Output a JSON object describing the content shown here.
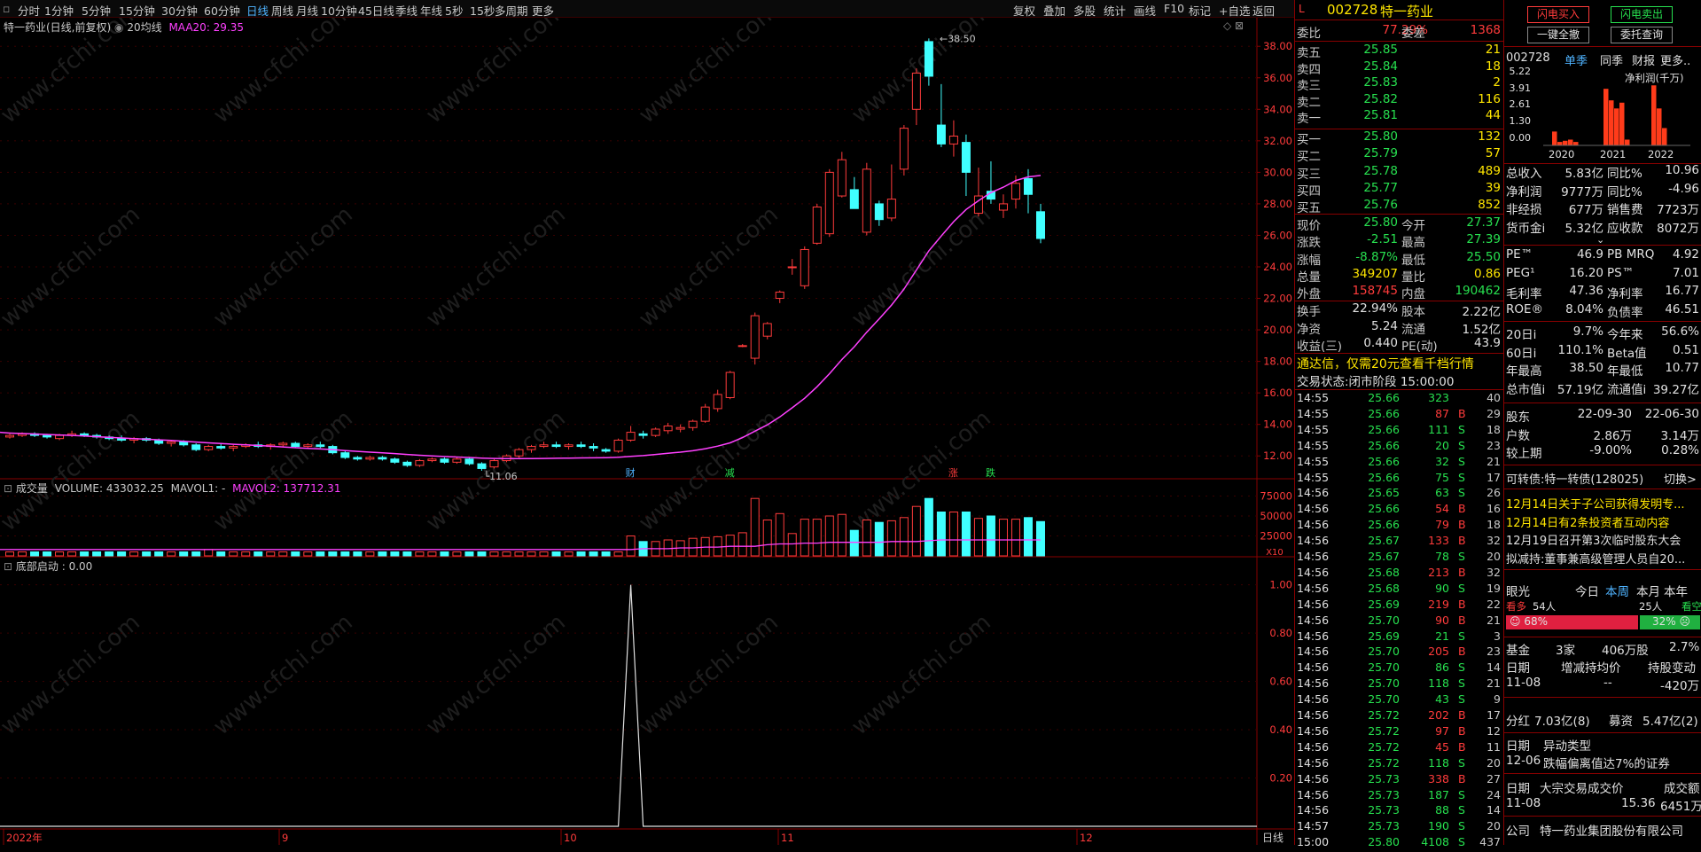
{
  "toolbar": {
    "periods": [
      "分时",
      "1分钟",
      "5分钟",
      "15分钟",
      "30分钟",
      "60分钟",
      "日线",
      "周线",
      "月线",
      "10分钟",
      "45日线",
      "季线",
      "年线",
      "5秒",
      "15秒",
      "多周期",
      "更多"
    ],
    "active": "日线",
    "right": [
      "复权",
      "叠加",
      "多股",
      "统计",
      "画线",
      "F10",
      "标记",
      "+自选",
      "返回"
    ]
  },
  "main_legend": {
    "title": "特一药业(日线,前复权)",
    "ma_name": "20均线",
    "ma_value": "MAA20: 29.35"
  },
  "volume_legend": {
    "label": "成交量",
    "volume": "VOLUME: 433032.25",
    "mavol1": "MAVOL1: -",
    "mavol2": "MAVOL2: 137712.31"
  },
  "indicator_legend": {
    "label": "底部启动",
    "value": ": 0.00"
  },
  "price_axis": [
    "38.00",
    "36.00",
    "34.00",
    "32.00",
    "30.00",
    "28.00",
    "26.00",
    "24.00",
    "22.00",
    "20.00",
    "18.00",
    "16.00",
    "14.00",
    "12.00"
  ],
  "volume_axis": [
    "75000",
    "50000",
    "25000"
  ],
  "volume_unit": "X10",
  "indicator_axis": [
    "1.00",
    "0.80",
    "0.60",
    "0.40",
    "0.20"
  ],
  "time_axis": [
    "2022年",
    "9",
    "10",
    "11",
    "12"
  ],
  "period_label": "日线",
  "annotations": {
    "high": "38.50",
    "low": "11.06",
    "events": [
      "财",
      "减",
      "涨",
      "跌"
    ]
  },
  "watermark": "www.cfchi.com",
  "chart_data": {
    "type": "candlestick",
    "symbol": "特一药业",
    "ylim": [
      11,
      38.8
    ],
    "candles": [
      [
        13.2,
        13.4,
        13.1,
        13.3
      ],
      [
        13.3,
        13.5,
        13.2,
        13.4
      ],
      [
        13.4,
        13.5,
        13.2,
        13.3
      ],
      [
        13.3,
        13.4,
        13.1,
        13.2
      ],
      [
        13.1,
        13.4,
        13.0,
        13.3
      ],
      [
        13.3,
        13.6,
        13.2,
        13.4
      ],
      [
        13.4,
        13.5,
        13.2,
        13.3
      ],
      [
        13.3,
        13.4,
        13.1,
        13.2
      ],
      [
        13.2,
        13.3,
        13.0,
        13.1
      ],
      [
        13.1,
        13.3,
        12.9,
        13.0
      ],
      [
        13.0,
        13.2,
        12.8,
        13.1
      ],
      [
        13.1,
        13.2,
        12.9,
        13.0
      ],
      [
        13.0,
        13.1,
        12.7,
        12.8
      ],
      [
        12.8,
        13.0,
        12.6,
        12.9
      ],
      [
        12.9,
        13.0,
        12.6,
        12.7
      ],
      [
        12.7,
        12.8,
        12.3,
        12.4
      ],
      [
        12.4,
        12.7,
        12.3,
        12.6
      ],
      [
        12.6,
        12.8,
        12.4,
        12.5
      ],
      [
        12.5,
        12.7,
        12.3,
        12.6
      ],
      [
        12.6,
        12.8,
        12.5,
        12.7
      ],
      [
        12.7,
        12.9,
        12.5,
        12.6
      ],
      [
        12.6,
        12.8,
        12.4,
        12.7
      ],
      [
        12.7,
        12.9,
        12.6,
        12.8
      ],
      [
        12.8,
        12.9,
        12.5,
        12.6
      ],
      [
        12.6,
        12.8,
        12.5,
        12.7
      ],
      [
        12.7,
        12.9,
        12.5,
        12.6
      ],
      [
        12.6,
        12.7,
        12.1,
        12.2
      ],
      [
        12.2,
        12.3,
        11.8,
        11.9
      ],
      [
        11.9,
        12.0,
        11.7,
        11.8
      ],
      [
        11.8,
        12.0,
        11.7,
        11.9
      ],
      [
        11.9,
        12.0,
        11.7,
        11.8
      ],
      [
        11.8,
        11.9,
        11.5,
        11.6
      ],
      [
        11.6,
        11.7,
        11.3,
        11.4
      ],
      [
        11.4,
        11.8,
        11.3,
        11.7
      ],
      [
        11.7,
        11.9,
        11.6,
        11.8
      ],
      [
        11.8,
        11.9,
        11.5,
        11.6
      ],
      [
        11.6,
        11.9,
        11.5,
        11.8
      ],
      [
        11.8,
        11.9,
        11.4,
        11.5
      ],
      [
        11.5,
        11.6,
        11.06,
        11.2
      ],
      [
        11.3,
        11.8,
        11.2,
        11.7
      ],
      [
        11.7,
        12.1,
        11.6,
        12.0
      ],
      [
        12.0,
        12.5,
        11.9,
        12.4
      ],
      [
        12.4,
        12.7,
        12.2,
        12.6
      ],
      [
        12.6,
        12.9,
        12.5,
        12.7
      ],
      [
        12.7,
        12.9,
        12.5,
        12.6
      ],
      [
        12.6,
        12.8,
        12.4,
        12.7
      ],
      [
        12.7,
        12.9,
        12.5,
        12.6
      ],
      [
        12.6,
        12.8,
        12.3,
        12.5
      ],
      [
        12.4,
        12.5,
        12.2,
        12.3
      ],
      [
        12.3,
        13.1,
        12.2,
        13.0
      ],
      [
        13.0,
        13.9,
        12.9,
        13.5
      ],
      [
        13.4,
        13.6,
        13.1,
        13.3
      ],
      [
        13.3,
        13.8,
        13.2,
        13.7
      ],
      [
        13.6,
        14.1,
        13.4,
        13.9
      ],
      [
        13.7,
        14.0,
        13.5,
        13.8
      ],
      [
        13.8,
        14.3,
        13.6,
        14.2
      ],
      [
        14.2,
        15.3,
        14.1,
        15.1
      ],
      [
        15.0,
        16.2,
        14.8,
        15.9
      ],
      [
        15.7,
        17.4,
        15.6,
        17.3
      ],
      [
        19.0,
        19.1,
        18.9,
        19.0
      ],
      [
        18.2,
        21.1,
        17.8,
        20.9
      ],
      [
        19.6,
        20.5,
        19.4,
        20.4
      ],
      [
        22.0,
        22.5,
        21.7,
        22.4
      ],
      [
        24.0,
        24.5,
        23.5,
        24.0
      ],
      [
        22.8,
        25.3,
        22.6,
        25.1
      ],
      [
        25.5,
        28.0,
        25.4,
        27.8
      ],
      [
        26.1,
        30.2,
        25.9,
        30.0
      ],
      [
        28.5,
        31.3,
        28.4,
        30.8
      ],
      [
        28.9,
        29.7,
        28.2,
        27.7
      ],
      [
        26.2,
        30.6,
        26.0,
        30.2
      ],
      [
        28.0,
        28.2,
        26.6,
        27.0
      ],
      [
        27.1,
        30.5,
        26.9,
        28.3
      ],
      [
        30.2,
        33.0,
        29.8,
        32.8
      ],
      [
        34.0,
        36.6,
        33.0,
        36.3
      ],
      [
        38.3,
        38.5,
        35.5,
        36.1
      ],
      [
        33.0,
        35.6,
        31.6,
        31.8
      ],
      [
        31.8,
        33.3,
        31.0,
        32.3
      ],
      [
        31.9,
        32.4,
        28.5,
        30.0
      ],
      [
        27.4,
        30.3,
        27.2,
        28.5
      ],
      [
        28.8,
        30.7,
        28.0,
        28.3
      ],
      [
        27.6,
        28.6,
        27.1,
        28.0
      ],
      [
        28.3,
        29.8,
        27.7,
        29.3
      ],
      [
        29.6,
        30.2,
        27.4,
        28.6
      ],
      [
        27.5,
        28.0,
        25.5,
        25.8
      ]
    ],
    "volume": [
      5,
      5,
      5,
      5,
      5,
      5,
      5,
      5,
      5,
      5,
      5,
      5,
      5,
      5,
      5,
      5,
      8,
      5,
      5,
      5,
      5,
      5,
      5,
      5,
      5,
      5,
      5,
      5,
      5,
      5,
      5,
      5,
      5,
      5,
      5,
      5,
      5,
      5,
      5,
      5,
      5,
      5,
      5,
      5,
      5,
      5,
      5,
      5,
      5,
      5,
      25,
      18,
      18,
      20,
      19,
      22,
      23,
      24,
      26,
      29,
      72,
      45,
      53,
      28,
      46,
      46,
      50,
      52,
      32,
      45,
      42,
      44,
      48,
      62,
      72,
      55,
      55,
      55,
      47,
      50,
      46,
      46,
      48,
      43
    ],
    "mavol2": [
      8,
      8,
      8,
      8,
      8,
      8,
      8,
      8,
      8,
      8,
      8,
      8,
      8,
      8,
      8,
      8,
      8,
      8,
      8,
      8,
      8,
      8,
      8,
      8,
      8,
      8,
      8,
      8,
      8,
      8,
      8,
      8,
      8,
      8,
      8,
      8,
      8,
      8,
      8,
      8,
      8,
      8,
      8,
      8,
      8,
      8,
      8,
      8,
      8,
      8,
      8,
      9,
      9,
      9,
      10,
      10,
      11,
      11,
      12,
      12,
      12,
      14,
      15,
      15,
      16,
      16,
      17,
      17,
      17,
      17,
      17,
      18,
      18,
      18,
      19,
      20,
      20,
      20,
      20,
      20,
      20,
      20,
      20,
      20
    ],
    "ma20": [
      13.45,
      13.42,
      13.39,
      13.36,
      13.33,
      13.3,
      13.26,
      13.22,
      13.18,
      13.14,
      13.1,
      13.06,
      13.02,
      12.98,
      12.93,
      12.88,
      12.83,
      12.79,
      12.74,
      12.7,
      12.66,
      12.62,
      12.57,
      12.52,
      12.48,
      12.44,
      12.4,
      12.34,
      12.29,
      12.24,
      12.2,
      12.15,
      12.09,
      12.04,
      12.0,
      11.96,
      11.93,
      11.9,
      11.86,
      11.84,
      11.83,
      11.83,
      11.83,
      11.84,
      11.85,
      11.86,
      11.87,
      11.88,
      11.89,
      11.91,
      11.97,
      12.02,
      12.09,
      12.17,
      12.24,
      12.33,
      12.46,
      12.62,
      12.83,
      13.16,
      13.57,
      13.97,
      14.47,
      15.06,
      15.66,
      16.39,
      17.22,
      18.12,
      18.93,
      19.85,
      20.69,
      21.58,
      22.59,
      23.8,
      25.02,
      25.96,
      26.87,
      27.64,
      28.2,
      28.71,
      29.06,
      29.48,
      29.71,
      29.8
    ],
    "indicator": [
      0,
      0,
      0,
      0,
      0,
      0,
      0,
      0,
      0,
      0,
      0,
      0,
      0,
      0,
      0,
      0,
      0,
      0,
      0,
      0,
      0,
      0,
      0,
      0,
      0,
      0,
      0,
      0,
      0,
      0,
      0,
      0,
      0,
      0,
      0,
      0,
      0,
      0,
      0,
      0,
      0,
      0,
      0,
      0,
      0,
      0,
      0,
      0,
      0,
      0,
      1,
      0,
      0,
      0,
      0,
      0,
      0,
      0,
      0,
      0,
      0,
      0,
      0,
      0,
      0,
      0,
      0,
      0,
      0,
      0,
      0,
      0,
      0,
      0,
      0,
      0,
      0,
      0,
      0,
      0,
      0,
      0,
      0,
      0
    ]
  },
  "quote": {
    "code": "002728",
    "name": "特一药业",
    "flag": "L",
    "weibi_label": "委比",
    "weibi": "77.29%",
    "weicha_label": "委差",
    "weicha": "1368",
    "asks": [
      {
        "label": "卖五",
        "price": "25.85",
        "vol": "21"
      },
      {
        "label": "卖四",
        "price": "25.84",
        "vol": "18"
      },
      {
        "label": "卖三",
        "price": "25.83",
        "vol": "2"
      },
      {
        "label": "卖二",
        "price": "25.82",
        "vol": "116"
      },
      {
        "label": "卖一",
        "price": "25.81",
        "vol": "44"
      }
    ],
    "bids": [
      {
        "label": "买一",
        "price": "25.80",
        "vol": "132"
      },
      {
        "label": "买二",
        "price": "25.79",
        "vol": "57"
      },
      {
        "label": "买三",
        "price": "25.78",
        "vol": "489"
      },
      {
        "label": "买四",
        "price": "25.77",
        "vol": "39"
      },
      {
        "label": "买五",
        "price": "25.76",
        "vol": "852"
      }
    ],
    "stats": [
      {
        "l1": "现价",
        "v1": "25.80",
        "c1": "grn",
        "l2": "今开",
        "v2": "27.37",
        "c2": "grn"
      },
      {
        "l1": "涨跌",
        "v1": "-2.51",
        "c1": "grn",
        "l2": "最高",
        "v2": "27.39",
        "c2": "grn"
      },
      {
        "l1": "涨幅",
        "v1": "-8.87%",
        "c1": "grn",
        "l2": "最低",
        "v2": "25.50",
        "c2": "grn"
      },
      {
        "l1": "总量",
        "v1": "349207",
        "c1": "yel",
        "l2": "量比",
        "v2": "0.86",
        "c2": "yel"
      },
      {
        "l1": "外盘",
        "v1": "158745",
        "c1": "red",
        "l2": "内盘",
        "v2": "190462",
        "c2": "grn"
      },
      {
        "l1": "换手",
        "v1": "22.94%",
        "c1": "wht",
        "l2": "股本",
        "v2": "2.22亿",
        "c2": "wht"
      },
      {
        "l1": "净资",
        "v1": "5.24",
        "c1": "wht",
        "l2": "流通",
        "v2": "1.52亿",
        "c2": "wht"
      },
      {
        "l1": "收益(三)",
        "v1": "0.440",
        "c1": "wht",
        "l2": "PE(动)",
        "v2": "43.9",
        "c2": "wht"
      }
    ],
    "promo": "通达信，仅需20元查看千档行情",
    "status": "交易状态:闭市阶段 15:00:00"
  },
  "ticks": [
    [
      "14:55",
      "25.66",
      "323",
      "",
      "40"
    ],
    [
      "14:55",
      "25.66",
      "87",
      "B",
      "29"
    ],
    [
      "14:55",
      "25.66",
      "111",
      "S",
      "18"
    ],
    [
      "14:55",
      "25.66",
      "20",
      "S",
      "23"
    ],
    [
      "14:55",
      "25.66",
      "32",
      "S",
      "21"
    ],
    [
      "14:55",
      "25.66",
      "75",
      "S",
      "17"
    ],
    [
      "14:56",
      "25.65",
      "63",
      "S",
      "26"
    ],
    [
      "14:56",
      "25.66",
      "54",
      "B",
      "16"
    ],
    [
      "14:56",
      "25.66",
      "79",
      "B",
      "18"
    ],
    [
      "14:56",
      "25.67",
      "133",
      "B",
      "32"
    ],
    [
      "14:56",
      "25.67",
      "78",
      "S",
      "20"
    ],
    [
      "14:56",
      "25.68",
      "213",
      "B",
      "32"
    ],
    [
      "14:56",
      "25.68",
      "90",
      "S",
      "19"
    ],
    [
      "14:56",
      "25.69",
      "219",
      "B",
      "22"
    ],
    [
      "14:56",
      "25.70",
      "90",
      "B",
      "21"
    ],
    [
      "14:56",
      "25.69",
      "21",
      "S",
      "3"
    ],
    [
      "14:56",
      "25.70",
      "205",
      "B",
      "23"
    ],
    [
      "14:56",
      "25.70",
      "86",
      "S",
      "14"
    ],
    [
      "14:56",
      "25.70",
      "118",
      "S",
      "21"
    ],
    [
      "14:56",
      "25.70",
      "43",
      "S",
      "9"
    ],
    [
      "14:56",
      "25.72",
      "202",
      "B",
      "17"
    ],
    [
      "14:56",
      "25.72",
      "97",
      "B",
      "12"
    ],
    [
      "14:56",
      "25.72",
      "45",
      "B",
      "11"
    ],
    [
      "14:56",
      "25.72",
      "118",
      "S",
      "20"
    ],
    [
      "14:56",
      "25.73",
      "338",
      "B",
      "27"
    ],
    [
      "14:56",
      "25.73",
      "187",
      "S",
      "24"
    ],
    [
      "14:56",
      "25.73",
      "88",
      "S",
      "14"
    ],
    [
      "14:57",
      "25.73",
      "190",
      "S",
      "20"
    ],
    [
      "15:00",
      "25.80",
      "4108",
      "S",
      "437"
    ]
  ],
  "f10": {
    "btn_buy": "闪电买入",
    "btn_sell": "闪电卖出",
    "btn_allin": "一键全撤",
    "btn_query": "委托查询",
    "code": "002728",
    "tabs": [
      "单季",
      "同季",
      "财报",
      "更多.."
    ],
    "profit_title": "净利润(千万)",
    "profit_axis": [
      "5.22",
      "3.91",
      "2.61",
      "1.30",
      "0.00"
    ],
    "years": [
      "2020",
      "2021",
      "2022"
    ],
    "profit_bars": [
      1.2,
      0.3,
      0.4,
      0.5,
      0.3,
      4.9,
      3.9,
      3.2,
      3.7,
      0.5,
      5.2,
      3.2,
      1.5
    ],
    "fin": [
      [
        "总收入",
        "5.83亿",
        "同比%",
        "10.96"
      ],
      [
        "净利润",
        "9777万",
        "同比%",
        "-4.96"
      ],
      [
        "非经损",
        "677万",
        "销售费",
        "7723万"
      ],
      [
        "货币金i",
        "5.32亿",
        "应收款",
        "8072万"
      ]
    ],
    "val": [
      [
        "PE™",
        "46.9",
        "PB MRQ",
        "4.92"
      ],
      [
        "PEG¹",
        "16.20",
        "PS™",
        "7.01"
      ],
      [
        "毛利率",
        "47.36",
        "净利率",
        "16.77"
      ],
      [
        "ROE®",
        "8.04%",
        "负债率",
        "46.51"
      ]
    ],
    "perf": [
      [
        "20日i",
        "9.7%",
        "今年来",
        "56.6%"
      ],
      [
        "60日i",
        "110.1%",
        "Beta值",
        "0.51"
      ],
      [
        "年最高",
        "38.50",
        "年最低",
        "10.77"
      ],
      [
        "总市值i",
        "57.19亿",
        "流通值i",
        "39.27亿"
      ]
    ],
    "holders": [
      [
        "股东",
        "22-09-30",
        "22-06-30"
      ],
      [
        "户数",
        "2.86万",
        "3.14万"
      ],
      [
        "较上期",
        "-9.00%",
        "0.28%"
      ]
    ],
    "bond": "可转债:特一转债(128025)",
    "bond_switch": "切换>",
    "news": [
      "12月14日关于子公司获得发明专...",
      "12月14日有2条投资者互动内容",
      "12月19日召开第3次临时股东大会",
      "拟减持:董事兼高级管理人员自20..."
    ],
    "eye": {
      "label": "眼光",
      "tabs": [
        "今日",
        "本周",
        "本月",
        "本年"
      ],
      "bull": "看多",
      "bull_n": "54人",
      "bear_n": "25人",
      "bear": "看空",
      "bull_pct": "68%",
      "bear_pct": "32%",
      "bull_ratio": 0.68
    },
    "fund": [
      "基金",
      "3家",
      "406万股",
      "2.7%"
    ],
    "fund_hdr": [
      "日期",
      "增减持均价",
      "持股变动"
    ],
    "fund_row": [
      "11-08",
      "--",
      "-420万"
    ],
    "div": [
      "分红",
      "7.03亿(8)",
      "募资",
      "5.47亿(2)"
    ],
    "anom_hdr": [
      "日期",
      "异动类型"
    ],
    "anom_row": [
      "12-06",
      "跌幅偏离值达7%的证券"
    ],
    "block_hdr": [
      "日期",
      "大宗交易成交价",
      "成交额"
    ],
    "block_row": [
      "11-08",
      "15.36",
      "6451万"
    ],
    "company": [
      "公司",
      "特一药业集团股份有限公司"
    ]
  }
}
